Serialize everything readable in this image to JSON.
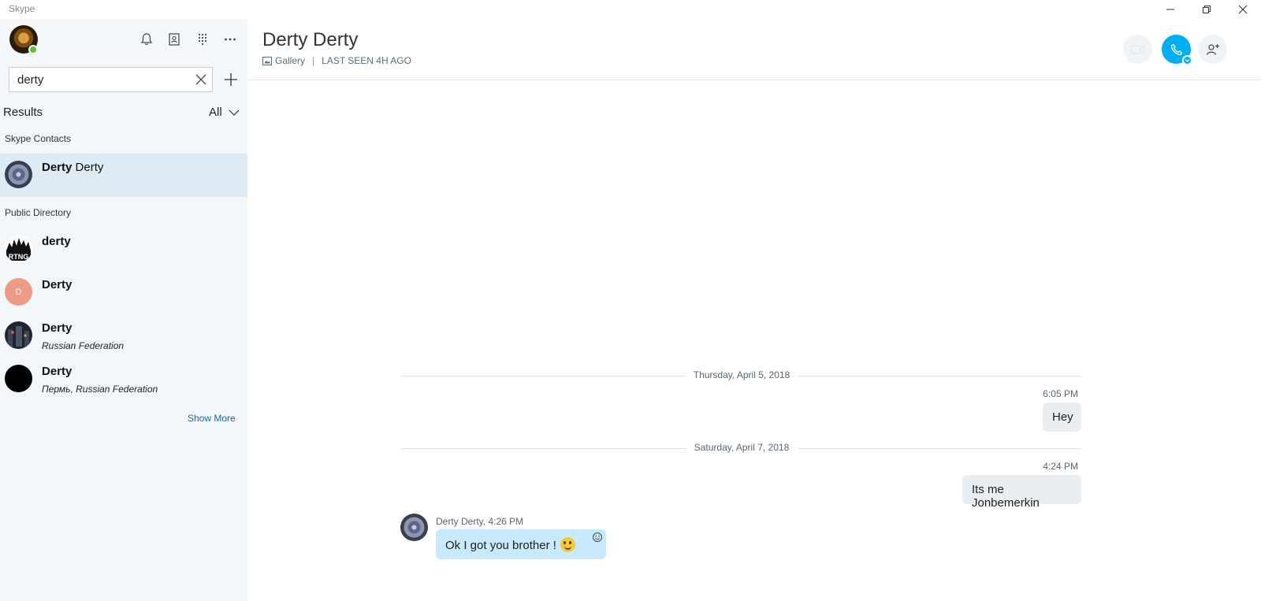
{
  "app": {
    "title": "Skype"
  },
  "sidebar": {
    "search": {
      "value": "derty",
      "placeholder": ""
    },
    "results_label": "Results",
    "filter_label": "All",
    "sections": {
      "skype_contacts": "Skype Contacts",
      "public_directory": "Public Directory"
    },
    "skype_contacts": [
      {
        "first": "Derty",
        "last": "Derty"
      }
    ],
    "public_directory": [
      {
        "name": "derty",
        "sub": ""
      },
      {
        "name": "Derty",
        "sub": "",
        "initial": "D"
      },
      {
        "name": "Derty",
        "sub": "Russian Federation"
      },
      {
        "name": "Derty",
        "sub": "Пермь, Russian Federation"
      }
    ],
    "show_more": "Show More"
  },
  "conversation": {
    "title": "Derty Derty",
    "gallery": "Gallery",
    "last_seen": "LAST SEEN 4H AGO",
    "groups": [
      {
        "date": "Thursday, April 5, 2018",
        "messages": [
          {
            "time": "6:05 PM",
            "text": "Hey"
          }
        ]
      },
      {
        "date": "Saturday, April 7, 2018",
        "messages": [
          {
            "time": "4:24 PM",
            "text": "Its me Jonbemerkin"
          }
        ]
      }
    ],
    "incoming": {
      "sender_time": "Derty Derty, 4:26 PM",
      "text": "Ok I got you brother !"
    }
  },
  "colors": {
    "accent": "#00aff0",
    "sidebar_bg": "#f3f7fa",
    "selected_bg": "#deebf4",
    "incoming_bubble": "#c7eafc",
    "outgoing_bubble": "#e8eef2",
    "presence": "#5bc236"
  }
}
